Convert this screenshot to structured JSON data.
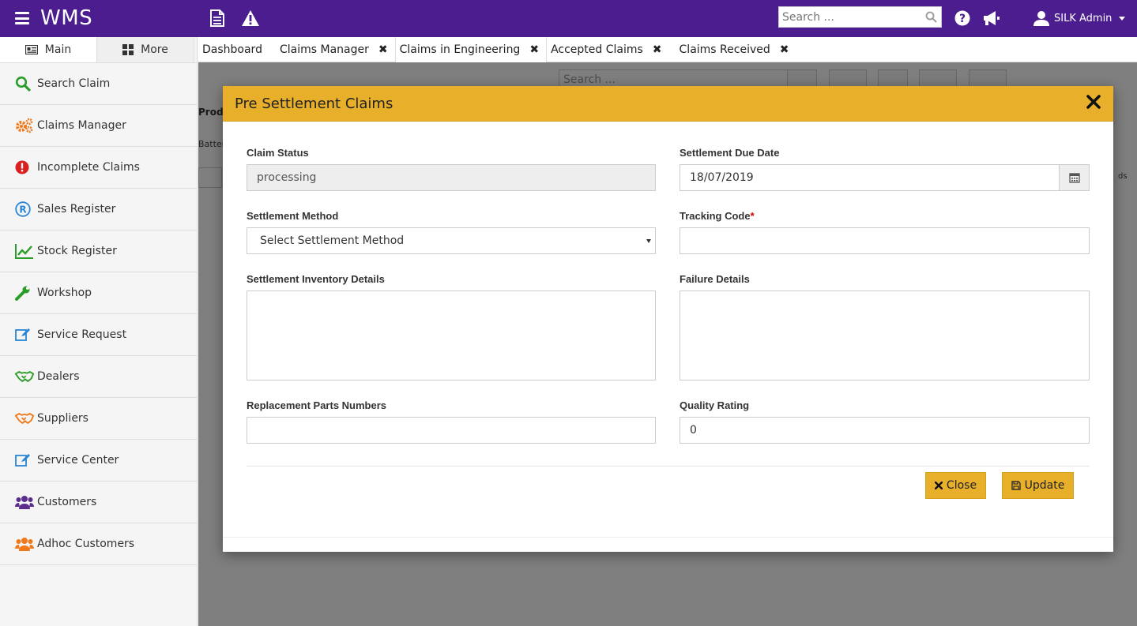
{
  "topbar": {
    "title": "WMS",
    "search_placeholder": "Search ...",
    "user_name": "SILK Admin"
  },
  "sidebar": {
    "tabs": [
      {
        "label": "Main"
      },
      {
        "label": "More"
      }
    ],
    "items": [
      {
        "label": "Search Claim",
        "icon": "search-icon",
        "color": "#2a9d2a"
      },
      {
        "label": "Claims Manager",
        "icon": "cogs-icon",
        "color": "#f07a1a"
      },
      {
        "label": "Incomplete Claims",
        "icon": "exclamation-circle-icon",
        "color": "#d9201f"
      },
      {
        "label": "Sales Register",
        "icon": "registered-icon",
        "color": "#2a86d4"
      },
      {
        "label": "Stock Register",
        "icon": "line-chart-icon",
        "color": "#2a9d2a"
      },
      {
        "label": "Workshop",
        "icon": "wrench-icon",
        "color": "#2a9d2a"
      },
      {
        "label": "Service Request",
        "icon": "edit-icon",
        "color": "#2a86d4"
      },
      {
        "label": "Dealers",
        "icon": "handshake-icon",
        "color": "#2a9d2a"
      },
      {
        "label": "Suppliers",
        "icon": "handshake-icon",
        "color": "#f07a1a"
      },
      {
        "label": "Service Center",
        "icon": "edit-icon",
        "color": "#2a86d4"
      },
      {
        "label": "Customers",
        "icon": "users-icon",
        "color": "#5b2d8f"
      },
      {
        "label": "Adhoc Customers",
        "icon": "users-icon",
        "color": "#f07a1a"
      }
    ]
  },
  "tabs": [
    {
      "label": "Dashboard",
      "closable": false
    },
    {
      "label": "Claims Manager",
      "closable": true
    },
    {
      "label": "Claims in Engineering",
      "closable": true
    },
    {
      "label": "Accepted Claims",
      "closable": true
    },
    {
      "label": "Claims Received",
      "closable": true
    }
  ],
  "background": {
    "search_placeholder": "Search ...",
    "column_header": "Produ",
    "cell_text": "Battery",
    "cell_text_right": "ds"
  },
  "modal": {
    "title": "Pre Settlement Claims",
    "claim_status_label": "Claim Status",
    "claim_status_value": "processing",
    "settlement_due_date_label": "Settlement Due Date",
    "settlement_due_date_value": "18/07/2019",
    "settlement_method_label": "Settlement Method",
    "settlement_method_value": "Select Settlement Method",
    "tracking_code_label": "Tracking Code",
    "tracking_code_required": "*",
    "settlement_inventory_label": "Settlement Inventory Details",
    "failure_details_label": "Failure Details",
    "replacement_parts_label": "Replacement Parts Numbers",
    "quality_rating_label": "Quality Rating",
    "quality_rating_value": "0",
    "close_button": "Close",
    "update_button": "Update"
  },
  "colors": {
    "topbar": "#4b1d8f",
    "accent": "#e8b02a"
  }
}
